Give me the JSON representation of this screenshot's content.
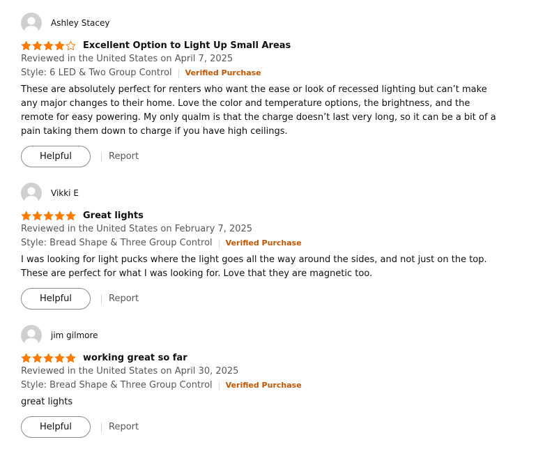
{
  "colors": {
    "star": "#ff7a00",
    "verified": "#c45500",
    "muted": "#565959",
    "text": "#0f1111"
  },
  "reviews": [
    {
      "reviewer": "Ashley Stacey",
      "rating": 4,
      "title": "Excellent Option to Light Up Small Areas",
      "reviewed_line": "Reviewed in the United States on April 7, 2025",
      "style_label": "Style: 6 LED & Two Group Control",
      "verified": "Verified Purchase",
      "body": "These are absolutely perfect for renters who want the ease or look of recessed lighting but can’t make any major changes to their home. Love the color and temperature options, the brightness, and the remote for easy powering. My only qualm is that the charge doesn’t last very long, so it can be a bit of a pain taking them down to charge if you have high ceilings.",
      "helpful_label": "Helpful",
      "report_label": "Report"
    },
    {
      "reviewer": "Vikki E",
      "rating": 5,
      "title": "Great lights",
      "reviewed_line": "Reviewed in the United States on February 7, 2025",
      "style_label": "Style: Bread Shape & Three Group Control",
      "verified": "Verified Purchase",
      "body": "I was looking for light pucks where the light goes all the way around the sides, and not just on the top. These are perfect for what I was looking for. Love that they are magnetic too.",
      "helpful_label": "Helpful",
      "report_label": "Report"
    },
    {
      "reviewer": "jim gilmore",
      "rating": 5,
      "title": "working great so far",
      "reviewed_line": "Reviewed in the United States on April 30, 2025",
      "style_label": "Style: Bread Shape & Three Group Control",
      "verified": "Verified Purchase",
      "body": "great lights",
      "helpful_label": "Helpful",
      "report_label": "Report"
    }
  ]
}
